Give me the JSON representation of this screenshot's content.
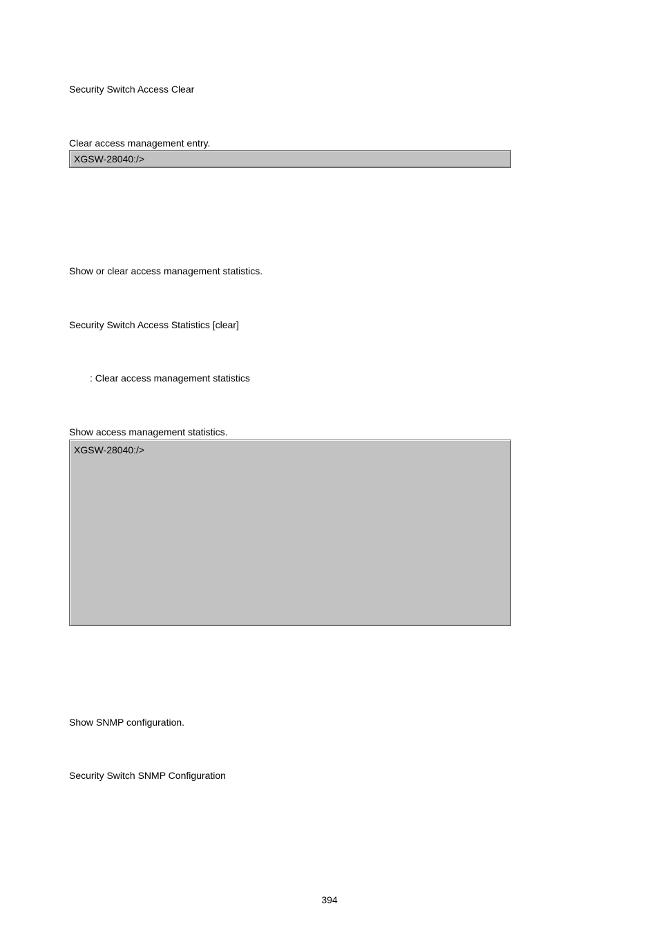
{
  "section1": {
    "syntax": "Security Switch Access Clear",
    "default": "Clear access management entry.",
    "prompt": "XGSW-28040:/>"
  },
  "section2": {
    "desc": "Show or clear access management statistics.",
    "syntax": "Security Switch Access Statistics [clear]",
    "param": ": Clear access management statistics",
    "default": "Show access management statistics.",
    "prompt": "XGSW-28040:/>"
  },
  "section3": {
    "desc": "Show SNMP configuration.",
    "syntax": "Security Switch SNMP Configuration"
  },
  "pageNumber": "394"
}
